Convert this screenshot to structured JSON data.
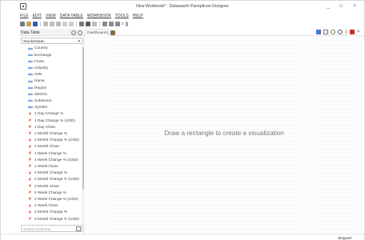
{
  "window": {
    "title": "New Workbook* - Datawatch Panopticon Designer",
    "minimize": "_",
    "maximize": "□",
    "close": "×"
  },
  "menu": [
    "FILE",
    "EDIT",
    "VIEW",
    "DATA TABLE",
    "WORKBOOK",
    "TOOLS",
    "HELP"
  ],
  "toolbar": {
    "zoom_text": "0"
  },
  "left_panel": {
    "title": "Data Table",
    "add_button": "+",
    "remove_button": "-",
    "table_select": "StocksStatic",
    "fields": [
      {
        "type": "text",
        "icon": "Abc",
        "label": "Country"
      },
      {
        "type": "text",
        "icon": "Abc",
        "label": "Exchange"
      },
      {
        "type": "text",
        "icon": "Abc",
        "label": "Fonts"
      },
      {
        "type": "text",
        "icon": "Abc",
        "label": "Industry"
      },
      {
        "type": "text",
        "icon": "Abc",
        "label": "ISIN"
      },
      {
        "type": "text",
        "icon": "Abc",
        "label": "Name"
      },
      {
        "type": "text",
        "icon": "Abc",
        "label": "Region"
      },
      {
        "type": "text",
        "icon": "Abc",
        "label": "SEDOL"
      },
      {
        "type": "text",
        "icon": "Abc",
        "label": "Subsector"
      },
      {
        "type": "text",
        "icon": "Abc",
        "label": "Symbol"
      },
      {
        "type": "num",
        "icon": "#",
        "label": "1 Day Change %"
      },
      {
        "type": "num",
        "icon": "#",
        "label": "1 Day Change % (USD)"
      },
      {
        "type": "num",
        "icon": "#",
        "label": "1 Day Close"
      },
      {
        "type": "num",
        "icon": "#",
        "label": "1 Month Change %"
      },
      {
        "type": "num",
        "icon": "#",
        "label": "1 Month Change % (USD)"
      },
      {
        "type": "num",
        "icon": "#",
        "label": "1 Month Close"
      },
      {
        "type": "num",
        "icon": "#",
        "label": "1 Week Change %"
      },
      {
        "type": "num",
        "icon": "#",
        "label": "1 Week Change % (USD)"
      },
      {
        "type": "num",
        "icon": "#",
        "label": "1 Week Close"
      },
      {
        "type": "num",
        "icon": "#",
        "label": "2 Month Change %"
      },
      {
        "type": "num",
        "icon": "#",
        "label": "2 Month Change % (USD)"
      },
      {
        "type": "num",
        "icon": "#",
        "label": "2 Month Close"
      },
      {
        "type": "num",
        "icon": "#",
        "label": "2 Week Change %"
      },
      {
        "type": "num",
        "icon": "#",
        "label": "2 Week Change % (USD)"
      },
      {
        "type": "num",
        "icon": "#",
        "label": "2 Week Close"
      },
      {
        "type": "num",
        "icon": "#",
        "label": "3 Month Change %"
      },
      {
        "type": "num",
        "icon": "#",
        "label": "3 Month Change % (USD)"
      }
    ],
    "search_placeholder": "Search Columns"
  },
  "tabs": [
    {
      "label": "Dashboard1"
    }
  ],
  "canvas": {
    "hint": "Draw a rectangle to create a visualization"
  },
  "status": {
    "text": "Stopped"
  },
  "colors": {
    "text_field_icon": "#2563c9",
    "numeric_field_icon": "#d14b2a",
    "tab_add": "#8b6a45"
  }
}
